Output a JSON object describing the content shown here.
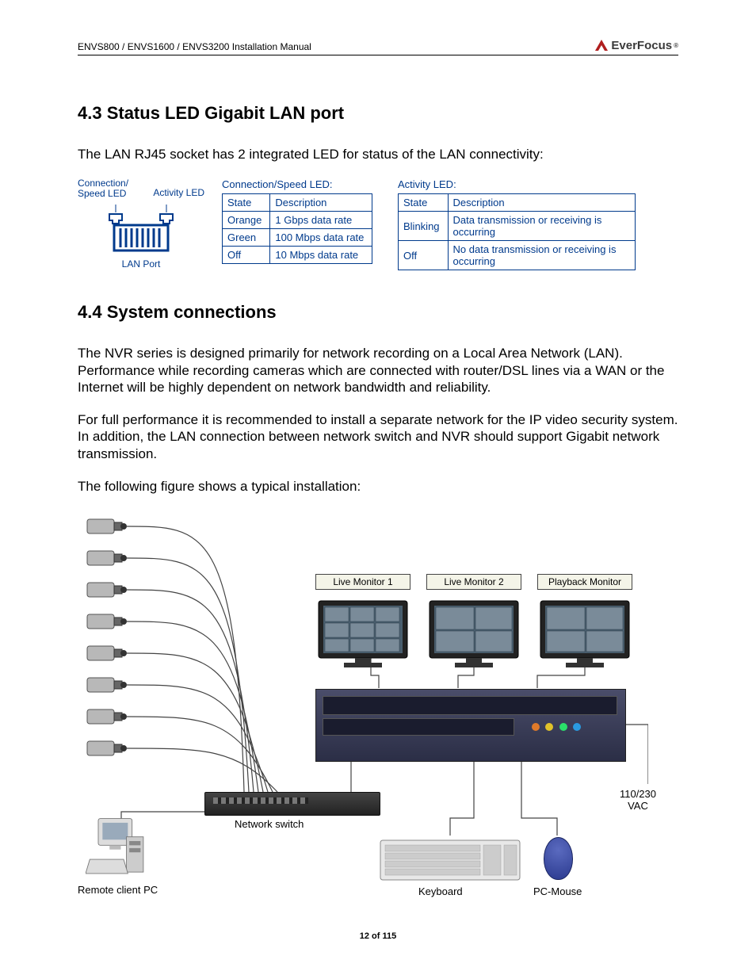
{
  "header": {
    "doc_title": "ENVS800 / ENVS1600 / ENVS3200 Installation Manual",
    "logo_text": "EverFocus",
    "logo_mark": "®"
  },
  "section43": {
    "heading": "4.3  Status LED Gigabit LAN port",
    "intro": "The LAN RJ45 socket has 2 integrated LED for status of the LAN connectivity:"
  },
  "lanport": {
    "left_label_line1": "Connection/",
    "left_label_line2": "Speed LED",
    "right_label": "Activity LED",
    "caption": "LAN Port"
  },
  "led_conn": {
    "title": "Connection/Speed LED:",
    "h1": "State",
    "h2": "Description",
    "rows": [
      {
        "state": "Orange",
        "desc": "1 Gbps data rate"
      },
      {
        "state": "Green",
        "desc": "100 Mbps data rate"
      },
      {
        "state": "Off",
        "desc": "10 Mbps data rate"
      }
    ]
  },
  "led_act": {
    "title": "Activity LED:",
    "h1": "State",
    "h2": "Description",
    "rows": [
      {
        "state": "Blinking",
        "desc": "Data transmission or receiving is occurring"
      },
      {
        "state": "Off",
        "desc": "No data transmission or receiving is occurring"
      }
    ]
  },
  "section44": {
    "heading": "4.4  System connections",
    "p1": "The NVR series is designed primarily for network recording on a Local Area Network (LAN). Performance while recording cameras which are connected with router/DSL lines via a WAN or the Internet will be highly dependent on network bandwidth and reliability.",
    "p2": "For full performance it is recommended to install a separate network for the IP video security system. In addition, the LAN connection between network switch and NVR should support Gigabit network transmission.",
    "p3": "The following figure shows a typical installation:"
  },
  "fig2": {
    "live1": "Live Monitor 1",
    "live2": "Live Monitor 2",
    "playback": "Playback Monitor",
    "switch": "Network switch",
    "remote": "Remote client PC",
    "keyboard": "Keyboard",
    "mouse": "PC-Mouse",
    "power_line1": "110/230",
    "power_line2": "VAC"
  },
  "footer": "12 of 115"
}
